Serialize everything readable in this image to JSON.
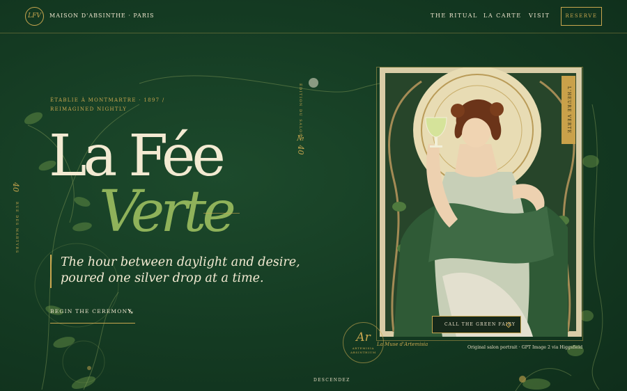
{
  "header": {
    "logo_text": "LFV",
    "brand": "MAISON D'ABSINTHE · PARIS",
    "nav": [
      {
        "label": "THE RITUAL"
      },
      {
        "label": "LA CARTE"
      },
      {
        "label": "VISIT"
      }
    ],
    "reserve_label": "RESERVE"
  },
  "hero": {
    "eyebrow_line1": "ÉTABLIE À MONTMARTRE · 1897 /",
    "eyebrow_line2": "REIMAGINED NIGHTLY",
    "title_line1": "La Fée",
    "title_line2": "Verte",
    "tagline_line1": "The hour between daylight and desire,",
    "tagline_line2": "poured one silver drop at a time.",
    "cta_label": "BEGIN THE CEREMONY",
    "cta_arrow": "↘"
  },
  "side": {
    "street_number": "40",
    "street_name": "RUE DES MARTYRS",
    "salon_edition": "ÉDITION DU SALON",
    "salon_number": "№ 40"
  },
  "portrait": {
    "vertical_badge": "L'HEURE VERTE",
    "call_button": "CALL THE GREEN FAIRY",
    "seal_symbol": "Ar",
    "seal_line1": "ARTEMISIA",
    "seal_line2": "ABSINTHIUM",
    "muse_caption": "La Muse d'Artemisia",
    "credit": "Original salon portrait · GPT Image 2 via Higgsfield"
  },
  "footer": {
    "scroll_cue": "DESCENDEZ"
  },
  "colors": {
    "background": "#143a22",
    "gold": "#c9a74f",
    "cream": "#f3ead2",
    "absinthe_green": "#8fb25a"
  }
}
